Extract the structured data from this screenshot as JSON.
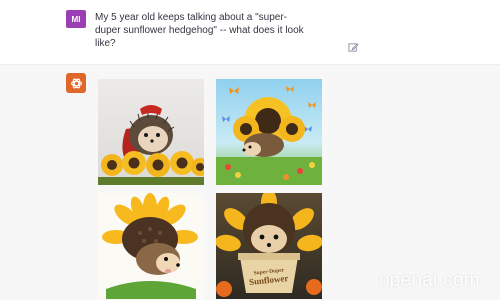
{
  "user": {
    "initials": "MI",
    "message": "My 5 year old keeps talking about a \"super-duper sunflower hedgehog\" -- what does it look like?",
    "avatar_color": "#9b3fb5"
  },
  "assistant": {
    "avatar_color": "#e0672a",
    "images": [
      {
        "description_icon": "hedgehog-superhero-image"
      },
      {
        "description_icon": "hedgehog-sunflower-meadow-image"
      },
      {
        "description_icon": "hedgehog-sunflower-head-image"
      },
      {
        "description_icon": "hedgehog-sunflower-pot-image",
        "pot_text": "Super-Duper Sunflower"
      }
    ]
  },
  "watermark": "openai.com",
  "colors": {
    "chat_bg": "#f7f7f8",
    "text": "#343541"
  }
}
